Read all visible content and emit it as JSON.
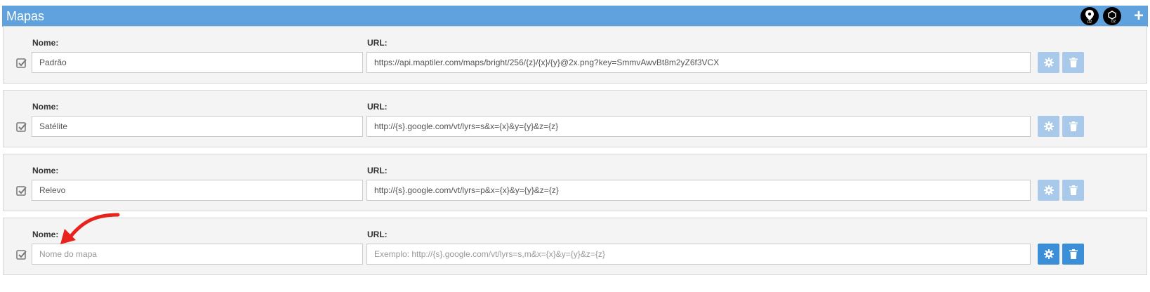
{
  "header": {
    "title": "Mapas",
    "badge1_text": "OZ",
    "badge2_text": "OZ",
    "add_label": "+"
  },
  "labels": {
    "name": "Nome:",
    "url": "URL:"
  },
  "rows": [
    {
      "name": "Padrão",
      "url": "https://api.maptiler.com/maps/bright/256/{z}/{x}/{y}@2x.png?key=SmmvAwvBt8m2yZ6f3VCX",
      "checked": true,
      "actions_enabled": false
    },
    {
      "name": "Satélite",
      "url": "http://{s}.google.com/vt/lyrs=s&x={x}&y={y}&z={z}",
      "checked": true,
      "actions_enabled": false
    },
    {
      "name": "Relevo",
      "url": "http://{s}.google.com/vt/lyrs=p&x={x}&y={y}&z={z}",
      "checked": true,
      "actions_enabled": false
    }
  ],
  "new_row": {
    "name_placeholder": "Nome do mapa",
    "url_placeholder": "Exemplo: http://{s}.google.com/vt/lyrs=s,m&x={x}&y={y}&z={z}",
    "checked": true,
    "actions_enabled": true
  },
  "colors": {
    "header": "#5fa2dd",
    "button_enabled": "#3b8ed8",
    "button_disabled": "#a9c9ea",
    "arrow": "#e8231b"
  },
  "icons": {
    "checkbox": "checkbox-checked-icon",
    "settings": "gear-icon",
    "delete": "trash-icon",
    "add": "plus-icon"
  }
}
